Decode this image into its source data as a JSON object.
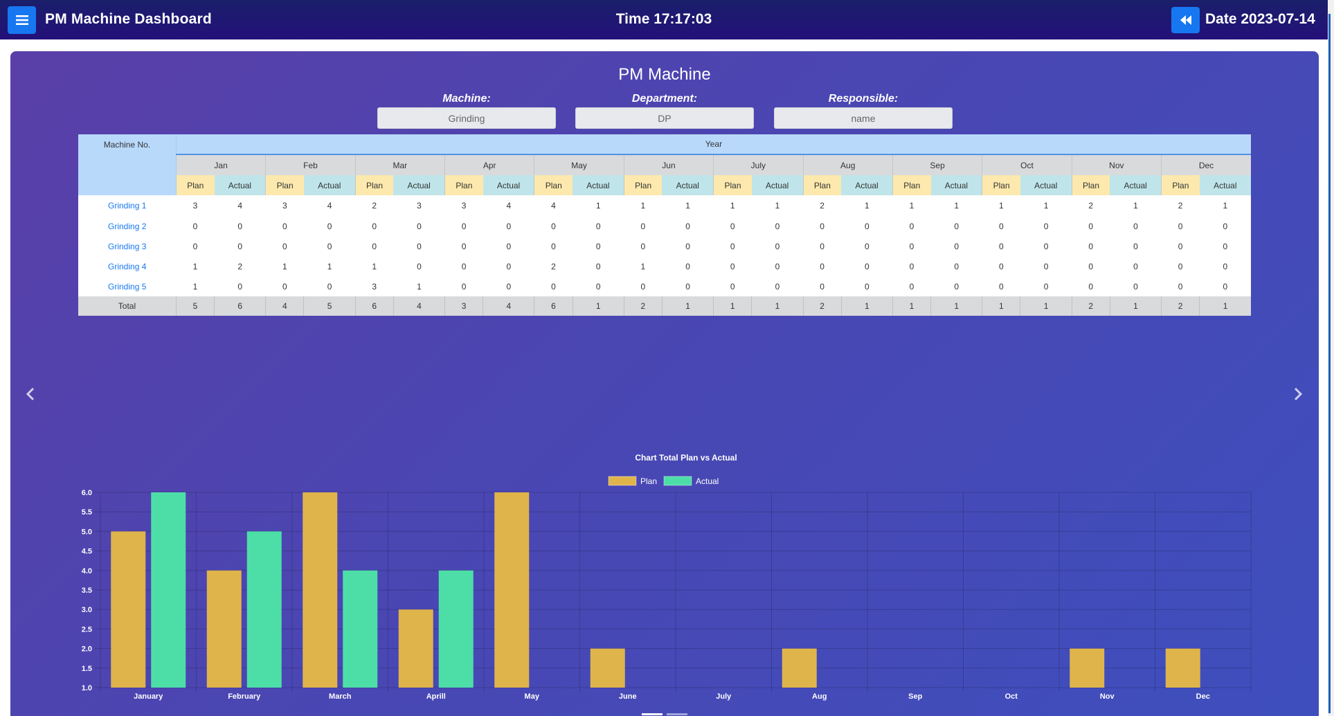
{
  "header": {
    "title": "PM Machine Dashboard",
    "time": "Time 17:17:03",
    "date": "Date 2023-07-14"
  },
  "panel": {
    "title": "PM Machine",
    "filters": [
      {
        "label": "Machine:",
        "value": "Grinding"
      },
      {
        "label": "Department:",
        "value": "DP"
      },
      {
        "label": "Responsible:",
        "value": "name"
      }
    ]
  },
  "table": {
    "machine_header": "Machine No.",
    "year_header": "Year",
    "plan_label": "Plan",
    "actual_label": "Actual",
    "total_label": "Total",
    "months": [
      "Jan",
      "Feb",
      "Mar",
      "Apr",
      "May",
      "Jun",
      "July",
      "Aug",
      "Sep",
      "Oct",
      "Nov",
      "Dec"
    ],
    "rows": [
      {
        "name": "Grinding 1",
        "values": [
          3,
          4,
          3,
          4,
          2,
          3,
          3,
          4,
          4,
          1,
          1,
          1,
          1,
          1,
          2,
          1,
          1,
          1,
          1,
          1,
          2,
          1,
          2,
          1
        ]
      },
      {
        "name": "Grinding 2",
        "values": [
          0,
          0,
          0,
          0,
          0,
          0,
          0,
          0,
          0,
          0,
          0,
          0,
          0,
          0,
          0,
          0,
          0,
          0,
          0,
          0,
          0,
          0,
          0,
          0
        ]
      },
      {
        "name": "Grinding 3",
        "values": [
          0,
          0,
          0,
          0,
          0,
          0,
          0,
          0,
          0,
          0,
          0,
          0,
          0,
          0,
          0,
          0,
          0,
          0,
          0,
          0,
          0,
          0,
          0,
          0
        ]
      },
      {
        "name": "Grinding 4",
        "values": [
          1,
          2,
          1,
          1,
          1,
          0,
          0,
          0,
          2,
          0,
          1,
          0,
          0,
          0,
          0,
          0,
          0,
          0,
          0,
          0,
          0,
          0,
          0,
          0
        ]
      },
      {
        "name": "Grinding 5",
        "values": [
          1,
          0,
          0,
          0,
          3,
          1,
          0,
          0,
          0,
          0,
          0,
          0,
          0,
          0,
          0,
          0,
          0,
          0,
          0,
          0,
          0,
          0,
          0,
          0
        ]
      }
    ],
    "totals": [
      5,
      6,
      4,
      5,
      6,
      4,
      3,
      4,
      6,
      1,
      2,
      1,
      1,
      1,
      2,
      1,
      1,
      1,
      1,
      1,
      2,
      1,
      2,
      1
    ]
  },
  "colors": {
    "plan": "#dfb44b",
    "actual": "#4ddea8",
    "link": "#1777f1",
    "button": "#1777f1"
  },
  "icons": {
    "menu": "hamburger-icon",
    "back": "rewind-icon",
    "prev": "chevron-left-icon",
    "next": "chevron-right-icon"
  },
  "chart_data": {
    "type": "bar",
    "title": "Chart Total Plan vs Actual",
    "categories": [
      "January",
      "February",
      "March",
      "Aprill",
      "May",
      "June",
      "July",
      "Aug",
      "Sep",
      "Oct",
      "Nov",
      "Dec"
    ],
    "series": [
      {
        "name": "Plan",
        "values": [
          5,
          4,
          6,
          3,
          6,
          2,
          1,
          2,
          1,
          1,
          2,
          2
        ]
      },
      {
        "name": "Actual",
        "values": [
          6,
          5,
          4,
          4,
          1,
          1,
          1,
          1,
          1,
          1,
          1,
          1
        ]
      }
    ],
    "ylim": [
      1.0,
      6.0
    ],
    "yticks": [
      "6.0",
      "5.5",
      "5.0",
      "4.5",
      "4.0",
      "3.5",
      "3.0",
      "2.5",
      "2.0",
      "1.5",
      "1.0"
    ],
    "grid": true,
    "legend": "top"
  }
}
